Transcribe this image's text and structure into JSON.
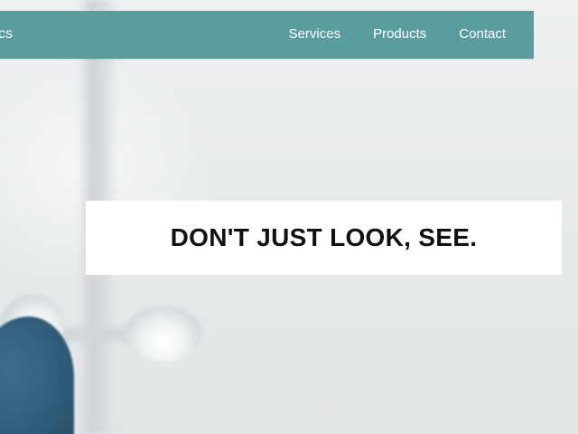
{
  "nav": {
    "brand_fragment": "cs",
    "links": [
      {
        "label": "Services"
      },
      {
        "label": "Products"
      },
      {
        "label": "Contact"
      }
    ]
  },
  "hero": {
    "tagline": "DON'T JUST LOOK, SEE."
  },
  "colors": {
    "nav_background": "#5b9d9f",
    "nav_text": "#ffffff",
    "tagline_box": "#ffffff",
    "tagline_text": "#111111"
  }
}
